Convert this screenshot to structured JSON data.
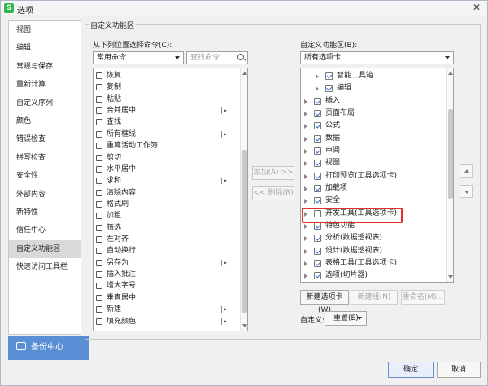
{
  "window": {
    "title": "选项",
    "app_icon": "S"
  },
  "sidebar": {
    "items": [
      {
        "label": "视图"
      },
      {
        "label": "编辑"
      },
      {
        "label": "常规与保存"
      },
      {
        "label": "重新计算"
      },
      {
        "label": "自定义序列"
      },
      {
        "label": "颜色"
      },
      {
        "label": "错误检查"
      },
      {
        "label": "拼写检查"
      },
      {
        "label": "安全性"
      },
      {
        "label": "外部内容"
      },
      {
        "label": "新特性"
      },
      {
        "label": "信任中心"
      },
      {
        "label": "自定义功能区",
        "active": true
      },
      {
        "label": "快速访问工具栏"
      }
    ],
    "backup_label": "备份中心"
  },
  "panel": {
    "group_title": "自定义功能区",
    "left_label": "从下列位置选择命令(C):",
    "left_source": "常用命令",
    "search_placeholder": "查找命令",
    "commands": [
      {
        "label": "恢复"
      },
      {
        "label": "复制"
      },
      {
        "label": "粘贴"
      },
      {
        "label": "合并居中",
        "sub": true
      },
      {
        "label": "查找"
      },
      {
        "label": "所有框线",
        "sub": true
      },
      {
        "label": "重算活动工作簿"
      },
      {
        "label": "剪切"
      },
      {
        "label": "水平居中"
      },
      {
        "label": "求和",
        "sub": true
      },
      {
        "label": "清除内容"
      },
      {
        "label": "格式刷"
      },
      {
        "label": "加粗"
      },
      {
        "label": "筛选"
      },
      {
        "label": "左对齐"
      },
      {
        "label": "自动换行"
      },
      {
        "label": "另存为",
        "sub": true
      },
      {
        "label": "插入批注"
      },
      {
        "label": "增大字号"
      },
      {
        "label": "垂直居中"
      },
      {
        "label": "新建",
        "sub": true
      },
      {
        "label": "填充颜色",
        "sub": true
      }
    ],
    "add_label": "添加(A) >>",
    "remove_label": "<< 删除(R)",
    "right_label": "自定义功能区(B):",
    "right_source": "所有选项卡",
    "tabs": [
      {
        "label": "智能工具箱",
        "checked": true,
        "level": 1
      },
      {
        "label": "编辑",
        "checked": true,
        "level": 1
      },
      {
        "label": "插入",
        "checked": true,
        "level": 0
      },
      {
        "label": "页面布局",
        "checked": true,
        "level": 0
      },
      {
        "label": "公式",
        "checked": true,
        "level": 0
      },
      {
        "label": "数据",
        "checked": true,
        "level": 0
      },
      {
        "label": "审阅",
        "checked": true,
        "level": 0
      },
      {
        "label": "视图",
        "checked": true,
        "level": 0
      },
      {
        "label": "打印预览(工具选项卡)",
        "checked": true,
        "level": 0
      },
      {
        "label": "加载项",
        "checked": true,
        "level": 0
      },
      {
        "label": "安全",
        "checked": true,
        "level": 0
      },
      {
        "label": "开发工具(工具选项卡)",
        "checked": false,
        "level": 0,
        "highlighted": true
      },
      {
        "label": "特色功能",
        "checked": true,
        "level": 0
      },
      {
        "label": "分析(数据透视表)",
        "checked": true,
        "level": 0
      },
      {
        "label": "设计(数据透视表)",
        "checked": true,
        "level": 0
      },
      {
        "label": "表格工具(工具选项卡)",
        "checked": true,
        "level": 0
      },
      {
        "label": "选项(切片器)",
        "checked": true,
        "level": 0
      }
    ],
    "new_tab_label": "新建选项卡(W)",
    "new_group_label": "新建组(N)",
    "rename_label": "重命名(M)...",
    "customize_label": "自定义:",
    "reset_label": "重置(E)"
  },
  "footer": {
    "ok_label": "确定",
    "cancel_label": "取消"
  },
  "colors": {
    "accent": "#5a8fd6",
    "highlight_border": "#e02f2f",
    "check": "#2a62c9"
  }
}
